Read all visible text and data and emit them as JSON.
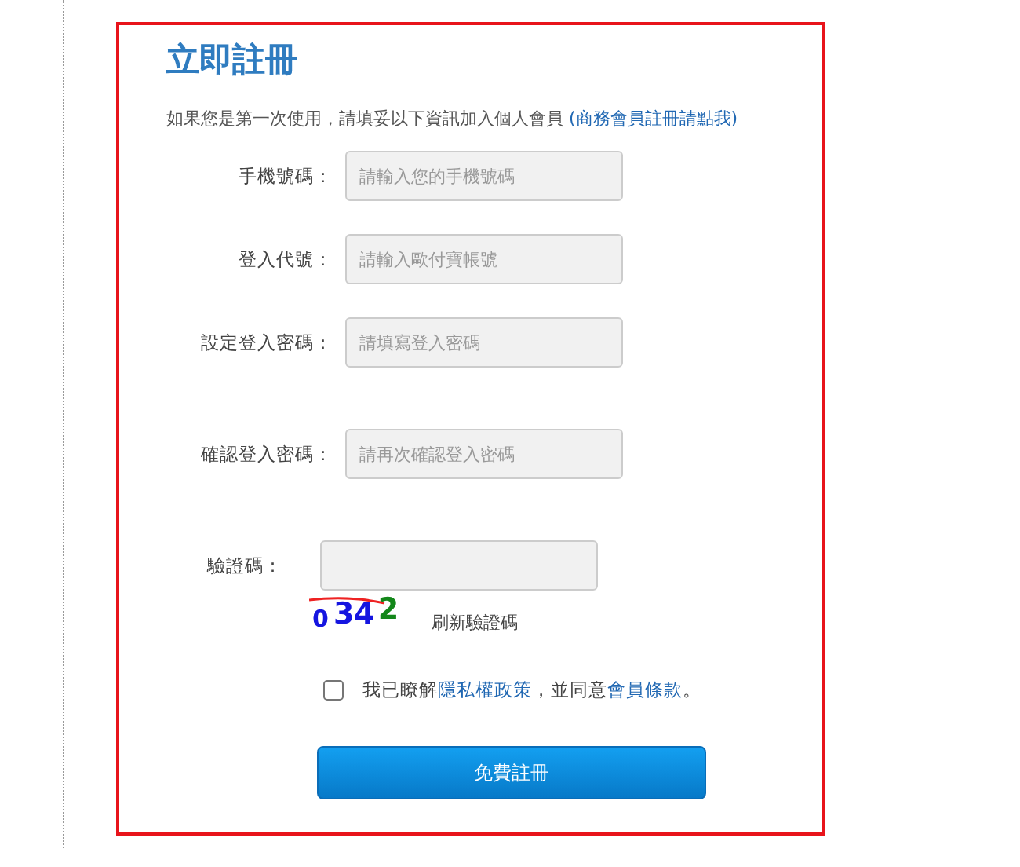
{
  "title": "立即註冊",
  "intro": {
    "text": "如果您是第一次使用，請填妥以下資訊加入個人會員 ",
    "link": "(商務會員註冊請點我)"
  },
  "fields": [
    {
      "label": "手機號碼：",
      "placeholder": "請輸入您的手機號碼"
    },
    {
      "label": "登入代號：",
      "placeholder": "請輸入歐付寶帳號"
    },
    {
      "label": "設定登入密碼：",
      "placeholder": "請填寫登入密碼"
    },
    {
      "label": "確認登入密碼：",
      "placeholder": "請再次確認登入密碼"
    },
    {
      "label": "驗證碼："
    }
  ],
  "captcha": {
    "code": "0342",
    "refresh": "刷新驗證碼"
  },
  "agreement": {
    "checked": false,
    "prefix": "我已瞭解",
    "privacy_link": "隱私權政策",
    "middle": "，並同意",
    "terms_link": "會員條款",
    "suffix": "。"
  },
  "submit": "免費註冊"
}
